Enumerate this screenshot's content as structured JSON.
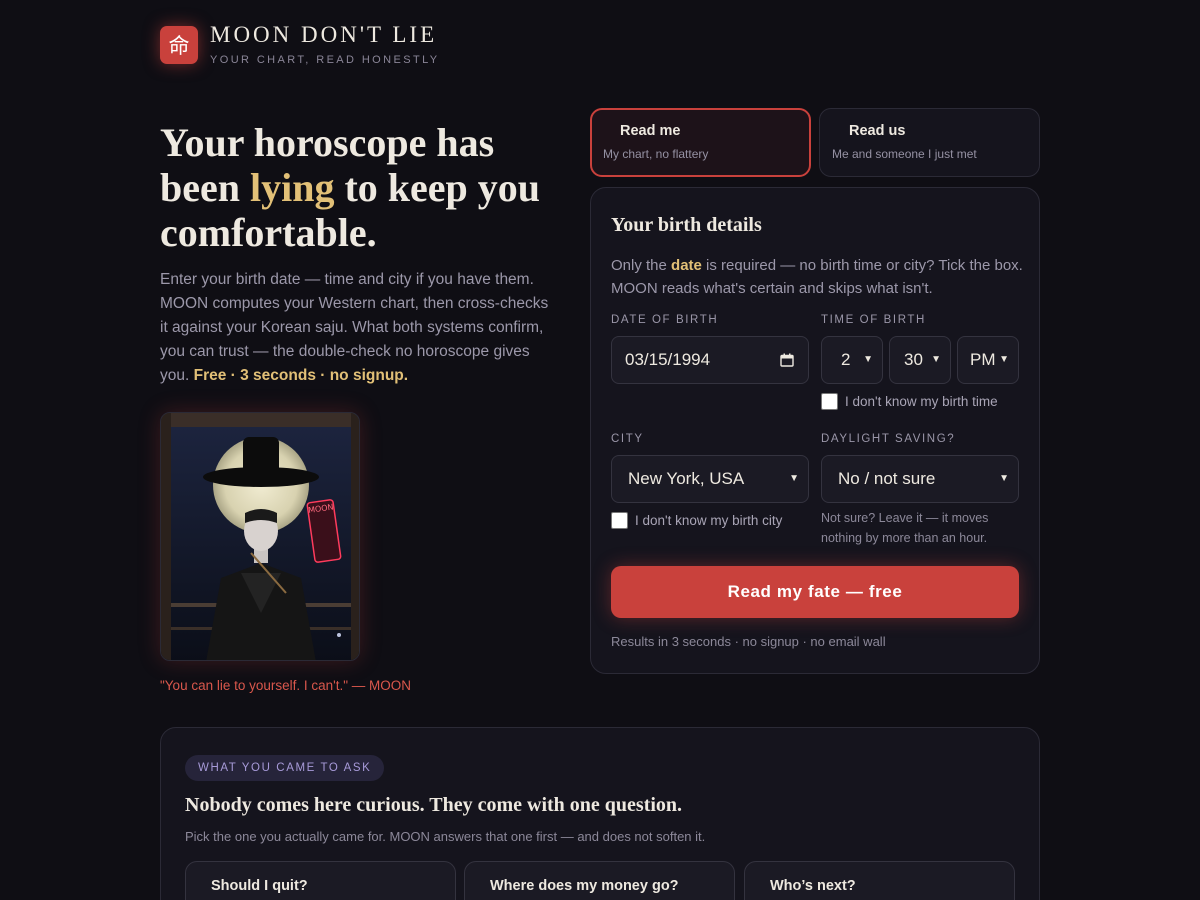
{
  "brand": {
    "logo_glyph": "命",
    "name": "MOON DON'T LIE",
    "tagline": "YOUR CHART, READ HONESTLY"
  },
  "hero": {
    "title_before": "Your horoscope has been ",
    "title_highlight": "lying",
    "title_after": " to keep you comfortable.",
    "body": "Enter your birth date — time and city if you have them. MOON computes your Western chart, then cross-checks it against your Korean saju. What both systems confirm, you can trust — the double-check no horoscope gives you. ",
    "body_highlight": "Free · 3 seconds · no signup.",
    "portrait_sign": "MOON",
    "quote": "\"You can lie to yourself. I can't.\" — MOON"
  },
  "modes": [
    {
      "title": "Read me",
      "subtitle": "My chart, no flattery",
      "active": true
    },
    {
      "title": "Read us",
      "subtitle": "Me and someone I just met",
      "active": false
    }
  ],
  "form": {
    "title": "Your birth details",
    "intro_before": "Only the ",
    "intro_highlight": "date",
    "intro_after": " is required — no birth time or city? Tick the box. MOON reads what's certain and skips what isn't.",
    "date_label": "DATE OF BIRTH",
    "date_value": "03/15/1994",
    "time_label": "TIME OF BIRTH",
    "hour": "2",
    "minute": "30",
    "ampm": "PM",
    "unknown_time_label": "I don't know my birth time",
    "city_label": "CITY",
    "city_value": "New York, USA",
    "unknown_city_label": "I don't know my birth city",
    "dst_label": "DAYLIGHT SAVING?",
    "dst_value": "No / not sure",
    "dst_note": "Not sure? Leave it — it moves nothing by more than an hour.",
    "submit_label": "Read my fate — free",
    "footer": "Results in 3 seconds · no signup · no email wall"
  },
  "ask": {
    "pill": "WHAT YOU CAME TO ASK",
    "title": "Nobody comes here curious. They come with one question.",
    "subtitle": "Pick the one you actually came for. MOON answers that one first — and does not soften it.",
    "questions": [
      "Should I quit?",
      "Where does my money go?",
      "Who’s next?"
    ]
  },
  "colors": {
    "background": "#0f0e14",
    "accent": "#c9413c",
    "gold": "#e2c077",
    "card": "#15141d"
  },
  "icons": {
    "calendar": "calendar-icon",
    "select": "chevron-down-icon"
  }
}
